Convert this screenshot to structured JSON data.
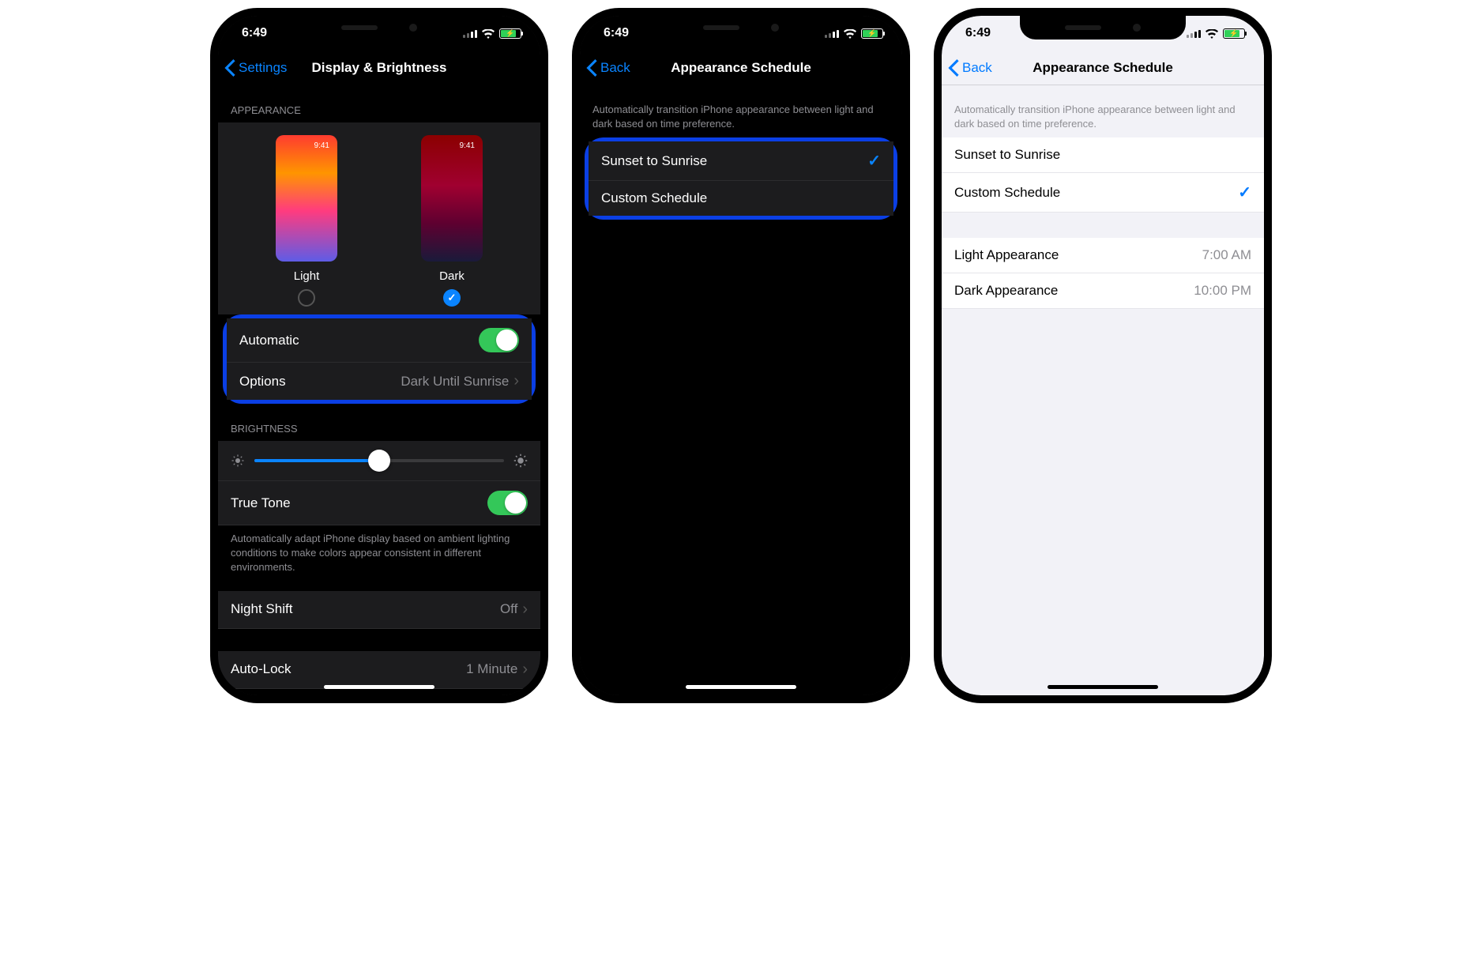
{
  "status": {
    "time": "6:49"
  },
  "screen1": {
    "back": "Settings",
    "title": "Display & Brightness",
    "appearance_header": "APPEARANCE",
    "light_label": "Light",
    "dark_label": "Dark",
    "thumb_time": "9:41",
    "automatic_label": "Automatic",
    "options_label": "Options",
    "options_value": "Dark Until Sunrise",
    "brightness_header": "BRIGHTNESS",
    "true_tone_label": "True Tone",
    "true_tone_desc": "Automatically adapt iPhone display based on ambient lighting conditions to make colors appear consistent in different environments.",
    "night_shift_label": "Night Shift",
    "night_shift_value": "Off",
    "auto_lock_label": "Auto-Lock",
    "auto_lock_value": "1 Minute"
  },
  "screen2": {
    "back": "Back",
    "title": "Appearance Schedule",
    "desc": "Automatically transition iPhone appearance between light and dark based on time preference.",
    "option1": "Sunset to Sunrise",
    "option2": "Custom Schedule"
  },
  "screen3": {
    "back": "Back",
    "title": "Appearance Schedule",
    "desc": "Automatically transition iPhone appearance between light and dark based on time preference.",
    "option1": "Sunset to Sunrise",
    "option2": "Custom Schedule",
    "light_row": "Light Appearance",
    "light_time": "7:00 AM",
    "dark_row": "Dark Appearance",
    "dark_time": "10:00 PM"
  }
}
